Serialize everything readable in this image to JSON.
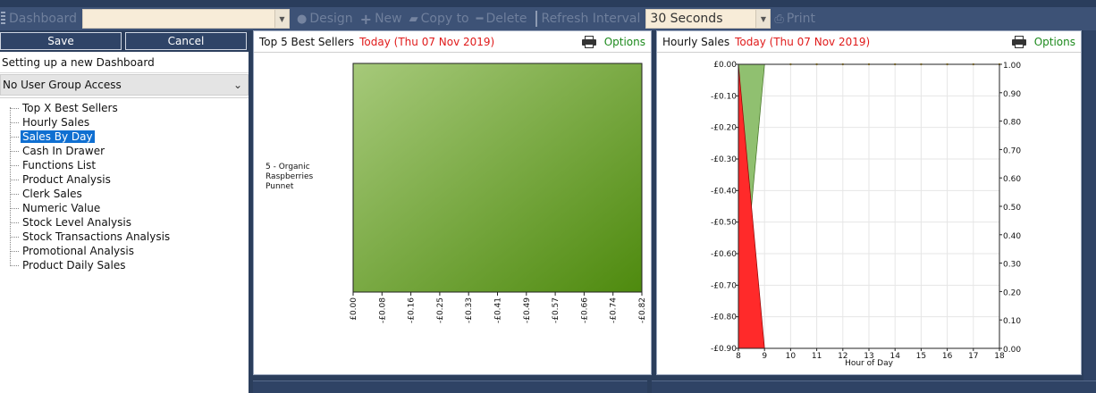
{
  "toolbar": {
    "dashboard_label": "Dashboard",
    "dashboard_value": "",
    "design_label": "Design",
    "new_label": "New",
    "copy_label": "Copy to",
    "delete_label": "Delete",
    "refresh_label": "Refresh Interval",
    "refresh_value": "30 Seconds",
    "print_label": "Print"
  },
  "left": {
    "save_label": "Save",
    "cancel_label": "Cancel",
    "dashboard_name": "Setting up a new Dashboard",
    "user_group": "No User Group Access",
    "widgets": [
      "Top X Best Sellers",
      "Hourly Sales",
      "Sales By Day",
      "Cash In Drawer",
      "Functions List",
      "Product Analysis",
      "Clerk Sales",
      "Numeric Value",
      "Stock Level Analysis",
      "Stock Transactions Analysis",
      "Promotional Analysis",
      "Product Daily Sales"
    ],
    "selected_index": 2
  },
  "panel1": {
    "title": "Top 5 Best Sellers",
    "date": "Today (Thu 07 Nov 2019)",
    "options_label": "Options"
  },
  "panel2": {
    "title": "Hourly Sales",
    "date": "Today (Thu 07 Nov 2019)",
    "options_label": "Options"
  },
  "colors": {
    "accent_red": "#e01a1a",
    "options_green": "#1d8a1d",
    "bar_green_light": "#a6c97a",
    "bar_green_dark": "#4e8a0e",
    "area_red": "#ff2a2a",
    "selection_blue": "#0f6fd1"
  },
  "chart_data": [
    {
      "type": "bar",
      "orientation": "horizontal",
      "categories": [
        "5 - Organic\nRaspberries\nPunnet"
      ],
      "values": [
        -0.82
      ],
      "xticks": [
        "£0.00",
        "-£0.08",
        "-£0.16",
        "-£0.25",
        "-£0.33",
        "-£0.41",
        "-£0.49",
        "-£0.57",
        "-£0.66",
        "-£0.74",
        "-£0.82"
      ],
      "xlim": [
        0,
        -0.82
      ]
    },
    {
      "type": "area",
      "x": [
        8,
        9,
        10,
        11,
        12,
        13,
        14,
        15,
        16,
        17,
        18
      ],
      "xlabel": "Hour of Day",
      "xticks": [
        "8",
        "9",
        "10",
        "11",
        "12",
        "13",
        "14",
        "15",
        "16",
        "17",
        "18"
      ],
      "yticks_left": [
        "£0.00",
        "-£0.10",
        "-£0.20",
        "-£0.30",
        "-£0.40",
        "-£0.50",
        "-£0.60",
        "-£0.70",
        "-£0.80",
        "-£0.90"
      ],
      "yticks_right": [
        "1.00",
        "0.90",
        "0.80",
        "0.70",
        "0.60",
        "0.50",
        "0.40",
        "0.30",
        "0.20",
        "0.10",
        "0.00"
      ],
      "ylim_left": [
        -0.9,
        0
      ],
      "ylim_right": [
        0,
        1
      ],
      "xlim": [
        8,
        18
      ],
      "grid": true,
      "series": [
        {
          "axis": "left",
          "color": "#ff2a2a",
          "values": [
            0,
            -0.9
          ]
        },
        {
          "axis": "right",
          "color": "#90c070",
          "values": [
            0,
            1,
            1,
            1,
            1,
            1,
            1,
            1,
            1,
            1,
            1
          ]
        }
      ]
    }
  ]
}
